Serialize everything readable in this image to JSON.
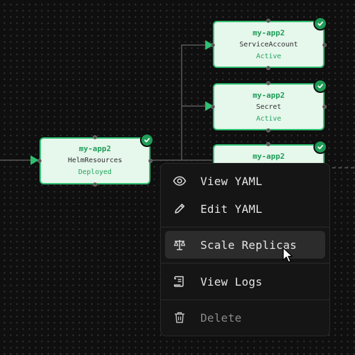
{
  "nodes": {
    "helm": {
      "name": "my-app2",
      "kind": "HelmResources",
      "status": "Deployed"
    },
    "service_account": {
      "name": "my-app2",
      "kind": "ServiceAccount",
      "status": "Active"
    },
    "secret": {
      "name": "my-app2",
      "kind": "Secret",
      "status": "Active"
    },
    "third": {
      "name": "my-app2"
    }
  },
  "context_menu": {
    "view_yaml": "View YAML",
    "edit_yaml": "Edit YAML",
    "scale_replicas": "Scale Replicas",
    "view_logs": "View Logs",
    "delete": "Delete"
  },
  "colors": {
    "canvas_bg": "#0f0f0f",
    "node_fill": "#e6f7ec",
    "node_border": "#2fbf71",
    "accent_green": "#1f9d58",
    "menu_bg": "#151515",
    "menu_hover": "#2c2c2c"
  },
  "icons": {
    "view_yaml": "eye-icon",
    "edit_yaml": "pencil-icon",
    "scale_replicas": "scale-icon",
    "view_logs": "scroll-icon",
    "delete": "trash-icon",
    "node_status": "check-icon"
  }
}
